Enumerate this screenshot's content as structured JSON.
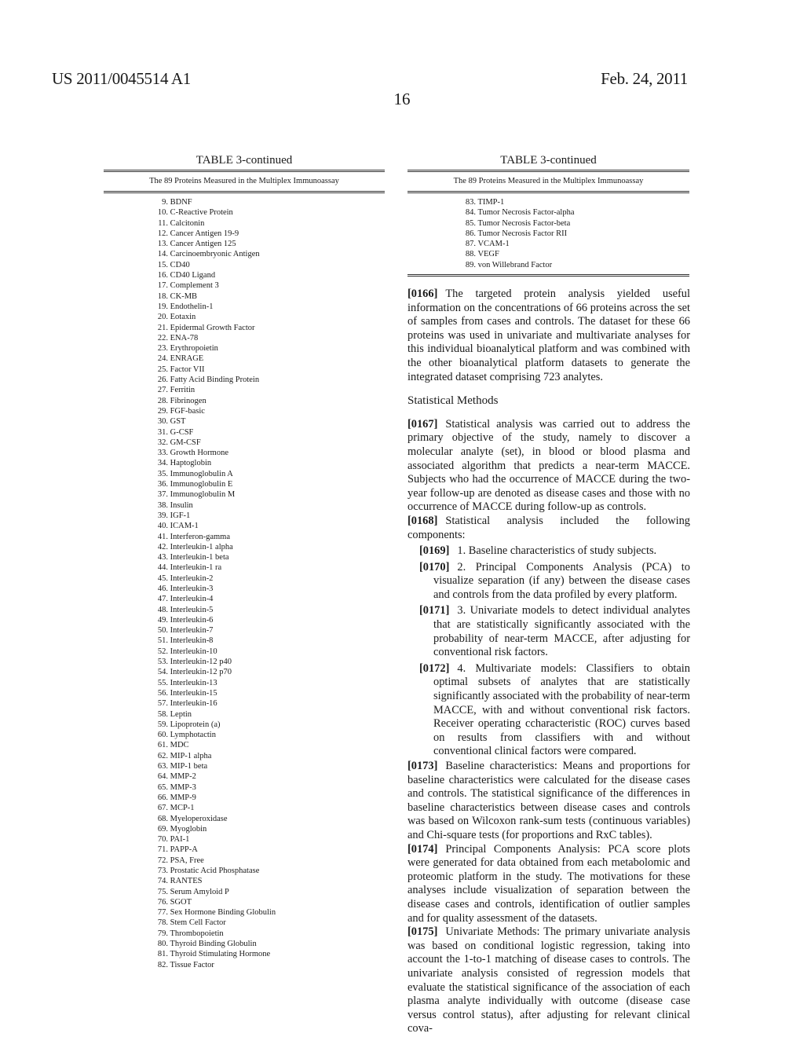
{
  "header": {
    "publication_number": "US 2011/0045514 A1",
    "date": "Feb. 24, 2011",
    "page_number": "16"
  },
  "table_left": {
    "title": "TABLE 3-continued",
    "caption": "The 89 Proteins Measured in the Multiplex Immunoassay",
    "items": [
      {
        "num": "9.",
        "name": "BDNF"
      },
      {
        "num": "10.",
        "name": "C-Reactive Protein"
      },
      {
        "num": "11.",
        "name": "Calcitonin"
      },
      {
        "num": "12.",
        "name": "Cancer Antigen 19-9"
      },
      {
        "num": "13.",
        "name": "Cancer Antigen 125"
      },
      {
        "num": "14.",
        "name": "Carcinoembryonic Antigen"
      },
      {
        "num": "15.",
        "name": "CD40"
      },
      {
        "num": "16.",
        "name": "CD40 Ligand"
      },
      {
        "num": "17.",
        "name": "Complement 3"
      },
      {
        "num": "18.",
        "name": "CK-MB"
      },
      {
        "num": "19.",
        "name": "Endothelin-1"
      },
      {
        "num": "20.",
        "name": "Eotaxin"
      },
      {
        "num": "21.",
        "name": "Epidermal Growth Factor"
      },
      {
        "num": "22.",
        "name": "ENA-78"
      },
      {
        "num": "23.",
        "name": "Erythropoietin"
      },
      {
        "num": "24.",
        "name": "ENRAGE"
      },
      {
        "num": "25.",
        "name": "Factor VII"
      },
      {
        "num": "26.",
        "name": "Fatty Acid Binding Protein"
      },
      {
        "num": "27.",
        "name": "Ferritin"
      },
      {
        "num": "28.",
        "name": "Fibrinogen"
      },
      {
        "num": "29.",
        "name": "FGF-basic"
      },
      {
        "num": "30.",
        "name": "GST"
      },
      {
        "num": "31.",
        "name": "G-CSF"
      },
      {
        "num": "32.",
        "name": "GM-CSF"
      },
      {
        "num": "33.",
        "name": "Growth Hormone"
      },
      {
        "num": "34.",
        "name": "Haptoglobin"
      },
      {
        "num": "35.",
        "name": "Immunoglobulin A"
      },
      {
        "num": "36.",
        "name": "Immunoglobulin E"
      },
      {
        "num": "37.",
        "name": "Immunoglobulin M"
      },
      {
        "num": "38.",
        "name": "Insulin"
      },
      {
        "num": "39.",
        "name": "IGF-1"
      },
      {
        "num": "40.",
        "name": "ICAM-1"
      },
      {
        "num": "41.",
        "name": "Interferon-gamma"
      },
      {
        "num": "42.",
        "name": "Interleukin-1 alpha"
      },
      {
        "num": "43.",
        "name": "Interleukin-1 beta"
      },
      {
        "num": "44.",
        "name": "Interleukin-1 ra"
      },
      {
        "num": "45.",
        "name": "Interleukin-2"
      },
      {
        "num": "46.",
        "name": "Interleukin-3"
      },
      {
        "num": "47.",
        "name": "Interleukin-4"
      },
      {
        "num": "48.",
        "name": "Interleukin-5"
      },
      {
        "num": "49.",
        "name": "Interleukin-6"
      },
      {
        "num": "50.",
        "name": "Interleukin-7"
      },
      {
        "num": "51.",
        "name": "Interleukin-8"
      },
      {
        "num": "52.",
        "name": "Interleukin-10"
      },
      {
        "num": "53.",
        "name": "Interleukin-12 p40"
      },
      {
        "num": "54.",
        "name": "Interleukin-12 p70"
      },
      {
        "num": "55.",
        "name": "Interleukin-13"
      },
      {
        "num": "56.",
        "name": "Interleukin-15"
      },
      {
        "num": "57.",
        "name": "Interleukin-16"
      },
      {
        "num": "58.",
        "name": "Leptin"
      },
      {
        "num": "59.",
        "name": "Lipoprotein (a)"
      },
      {
        "num": "60.",
        "name": "Lymphotactin"
      },
      {
        "num": "61.",
        "name": "MDC"
      },
      {
        "num": "62.",
        "name": "MIP-1 alpha"
      },
      {
        "num": "63.",
        "name": "MIP-1 beta"
      },
      {
        "num": "64.",
        "name": "MMP-2"
      },
      {
        "num": "65.",
        "name": "MMP-3"
      },
      {
        "num": "66.",
        "name": "MMP-9"
      },
      {
        "num": "67.",
        "name": "MCP-1"
      },
      {
        "num": "68.",
        "name": "Myeloperoxidase"
      },
      {
        "num": "69.",
        "name": "Myoglobin"
      },
      {
        "num": "70.",
        "name": "PAI-1"
      },
      {
        "num": "71.",
        "name": "PAPP-A"
      },
      {
        "num": "72.",
        "name": "PSA, Free"
      },
      {
        "num": "73.",
        "name": "Prostatic Acid Phosphatase"
      },
      {
        "num": "74.",
        "name": "RANTES"
      },
      {
        "num": "75.",
        "name": "Serum Amyloid P"
      },
      {
        "num": "76.",
        "name": "SGOT"
      },
      {
        "num": "77.",
        "name": "Sex Hormone Binding Globulin"
      },
      {
        "num": "78.",
        "name": "Stem Cell Factor"
      },
      {
        "num": "79.",
        "name": "Thrombopoietin"
      },
      {
        "num": "80.",
        "name": "Thyroid Binding Globulin"
      },
      {
        "num": "81.",
        "name": "Thyroid Stimulating Hormone"
      },
      {
        "num": "82.",
        "name": "Tissue Factor"
      }
    ]
  },
  "table_right": {
    "title": "TABLE 3-continued",
    "caption": "The 89 Proteins Measured in the Multiplex Immunoassay",
    "items": [
      {
        "num": "83.",
        "name": "TIMP-1"
      },
      {
        "num": "84.",
        "name": "Tumor Necrosis Factor-alpha"
      },
      {
        "num": "85.",
        "name": "Tumor Necrosis Factor-beta"
      },
      {
        "num": "86.",
        "name": "Tumor Necrosis Factor RII"
      },
      {
        "num": "87.",
        "name": "VCAM-1"
      },
      {
        "num": "88.",
        "name": "VEGF"
      },
      {
        "num": "89.",
        "name": "von Willebrand Factor"
      }
    ]
  },
  "body": {
    "p0166": {
      "num": "[0166]",
      "text": "The targeted protein analysis yielded useful information on the concentrations of 66 proteins across the set of samples from cases and controls. The dataset for these 66 proteins was used in univariate and multivariate analyses for this individual bioanalytical platform and was combined with the other bioanalytical platform datasets to generate the integrated dataset comprising 723 analytes."
    },
    "section_heading": "Statistical Methods",
    "p0167": {
      "num": "[0167]",
      "text": "Statistical analysis was carried out to address the primary objective of the study, namely to discover a molecular analyte (set), in blood or blood plasma and associated algorithm that predicts a near-term MACCE. Subjects who had the occurrence of MACCE during the two-year follow-up are denoted as disease cases and those with no occurrence of MACCE during follow-up as controls."
    },
    "p0168": {
      "num": "[0168]",
      "text": "Statistical analysis included the following components:"
    },
    "p0169": {
      "num": "[0169]",
      "text": "1. Baseline characteristics of study subjects."
    },
    "p0170": {
      "num": "[0170]",
      "text": "2. Principal Components Analysis (PCA) to visualize separation (if any) between the disease cases and controls from the data profiled by every platform."
    },
    "p0171": {
      "num": "[0171]",
      "text": "3. Univariate models to detect individual analytes that are statistically significantly associated with the probability of near-term MACCE, after adjusting for conventional risk factors."
    },
    "p0172": {
      "num": "[0172]",
      "text": "4. Multivariate models: Classifiers to obtain optimal subsets of analytes that are statistically significantly associated with the probability of near-term MACCE, with and without conventional risk factors. Receiver operating ccharacteristic (ROC) curves based on results from classifiers with and without conventional clinical factors were compared."
    },
    "p0173": {
      "num": "[0173]",
      "text": "Baseline characteristics: Means and proportions for baseline characteristics were calculated for the disease cases and controls. The statistical significance of the differences in baseline characteristics between disease cases and controls was based on Wilcoxon rank-sum tests (continuous variables) and Chi-square tests (for proportions and RxC tables)."
    },
    "p0174": {
      "num": "[0174]",
      "text": "Principal Components Analysis: PCA score plots were generated for data obtained from each metabolomic and proteomic platform in the study. The motivations for these analyses include visualization of separation between the disease cases and controls, identification of outlier samples and for quality assessment of the datasets."
    },
    "p0175": {
      "num": "[0175]",
      "text": "Univariate Methods: The primary univariate analysis was based on conditional logistic regression, taking into account the 1-to-1 matching of disease cases to controls. The univariate analysis consisted of regression models that evaluate the statistical significance of the association of each plasma analyte individually with outcome (disease case versus control status), after adjusting for relevant clinical cova-"
    }
  }
}
